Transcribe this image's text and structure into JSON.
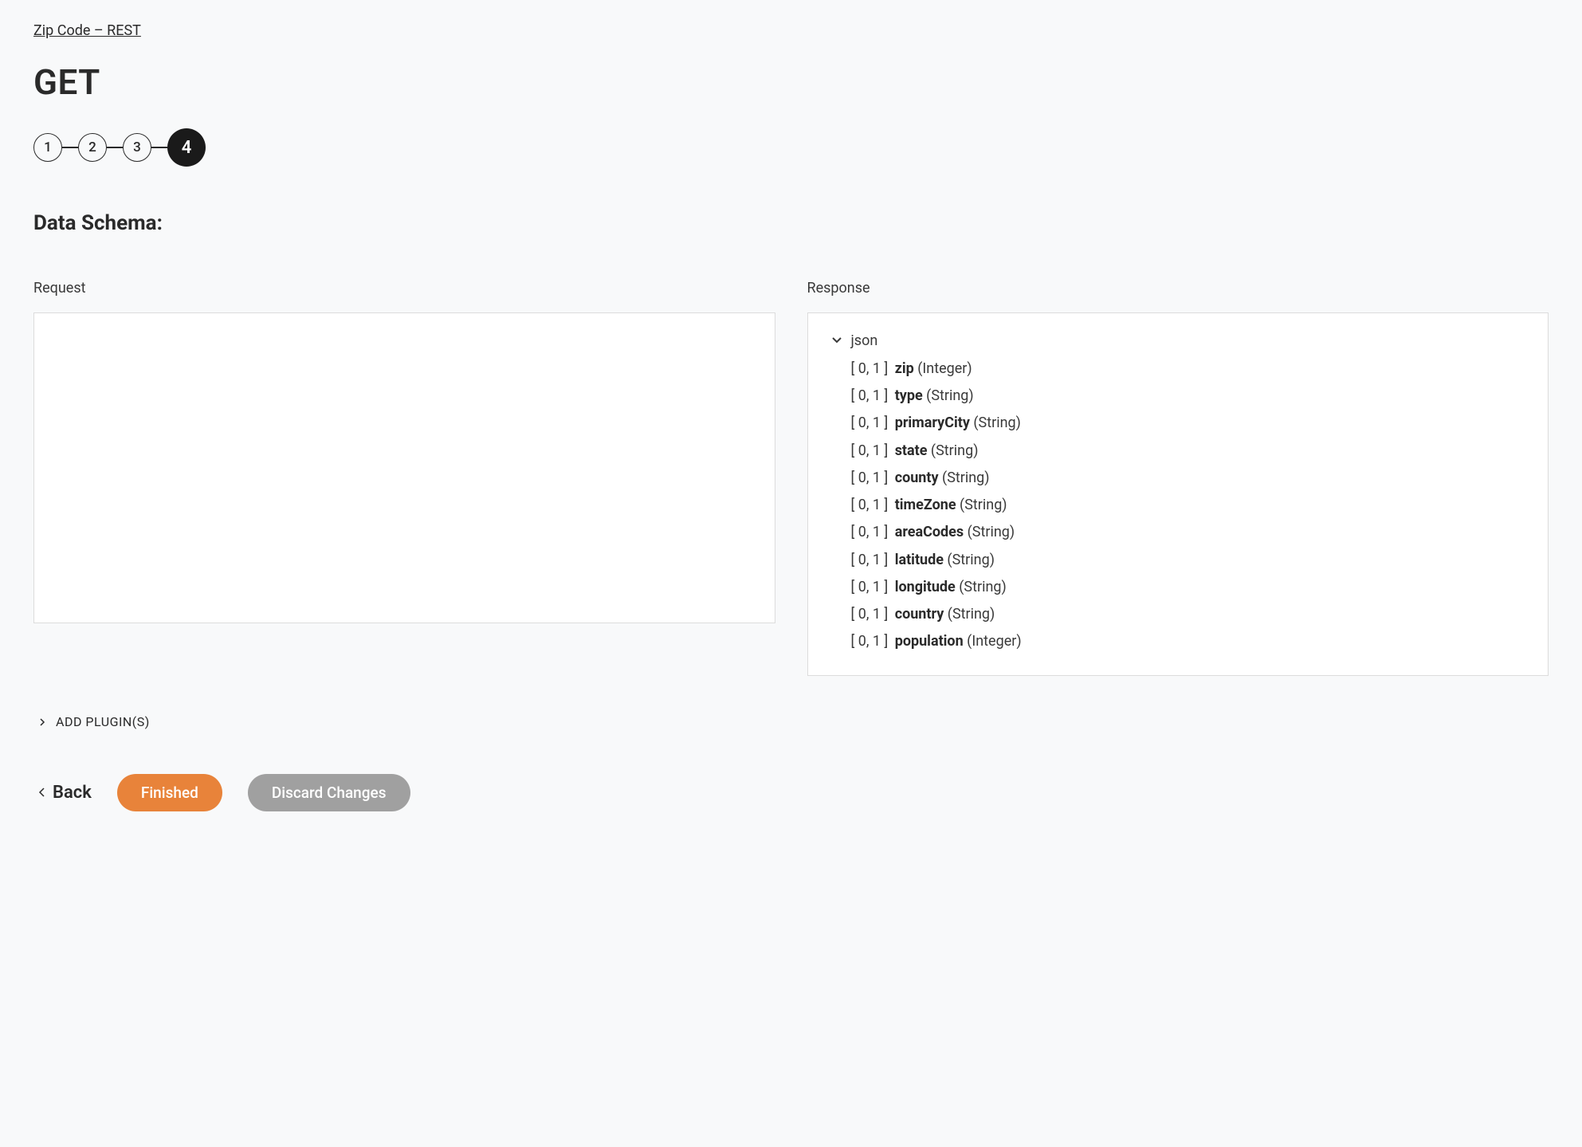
{
  "breadcrumb": "Zip Code – REST",
  "page_title": "GET",
  "stepper": {
    "steps": [
      "1",
      "2",
      "3",
      "4"
    ],
    "active_index": 3
  },
  "section_title": "Data Schema:",
  "schema": {
    "request": {
      "label": "Request"
    },
    "response": {
      "label": "Response",
      "root_label": "json",
      "fields": [
        {
          "cardinality": "[ 0, 1 ]",
          "name": "zip",
          "type": "(Integer)"
        },
        {
          "cardinality": "[ 0, 1 ]",
          "name": "type",
          "type": "(String)"
        },
        {
          "cardinality": "[ 0, 1 ]",
          "name": "primaryCity",
          "type": "(String)"
        },
        {
          "cardinality": "[ 0, 1 ]",
          "name": "state",
          "type": "(String)"
        },
        {
          "cardinality": "[ 0, 1 ]",
          "name": "county",
          "type": "(String)"
        },
        {
          "cardinality": "[ 0, 1 ]",
          "name": "timeZone",
          "type": "(String)"
        },
        {
          "cardinality": "[ 0, 1 ]",
          "name": "areaCodes",
          "type": "(String)"
        },
        {
          "cardinality": "[ 0, 1 ]",
          "name": "latitude",
          "type": "(String)"
        },
        {
          "cardinality": "[ 0, 1 ]",
          "name": "longitude",
          "type": "(String)"
        },
        {
          "cardinality": "[ 0, 1 ]",
          "name": "country",
          "type": "(String)"
        },
        {
          "cardinality": "[ 0, 1 ]",
          "name": "population",
          "type": "(Integer)"
        }
      ]
    }
  },
  "add_plugins_label": "ADD PLUGIN(S)",
  "buttons": {
    "back": "Back",
    "finished": "Finished",
    "discard": "Discard Changes"
  }
}
